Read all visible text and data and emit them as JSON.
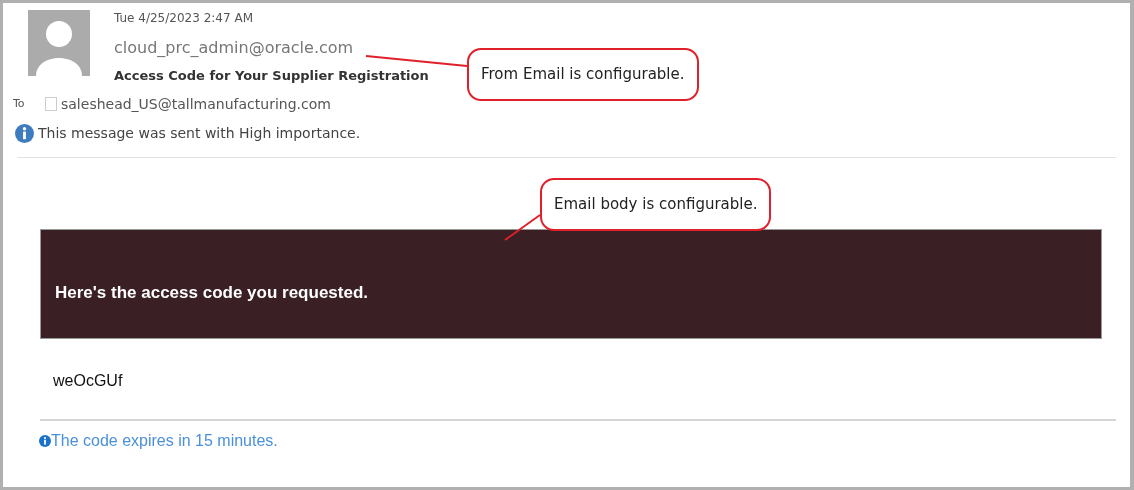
{
  "message": {
    "date": "Tue 4/25/2023 2:47 AM",
    "from": "cloud_prc_admin@oracle.com",
    "subject": "Access Code for Your Supplier Registration",
    "to_label": "To",
    "to": "saleshead_US@tallmanufacturing.com",
    "to_checked": false,
    "importance_note": "This message was sent with High importance."
  },
  "body": {
    "banner": "Here's the access code you requested.",
    "code": "weOcGUf",
    "footer_note": "The code expires in 15 minutes."
  },
  "callouts": [
    "From Email is configurable.",
    "Email body is configurable."
  ]
}
